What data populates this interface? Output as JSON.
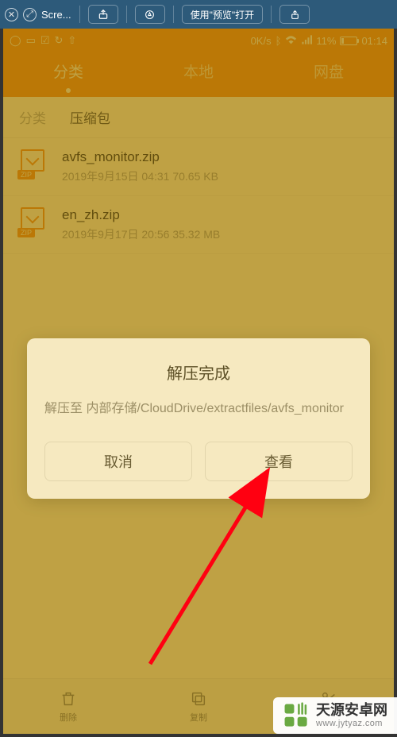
{
  "topbar": {
    "title": "Scre...",
    "open_label": "使用\"预览\"打开"
  },
  "statusbar": {
    "speed": "0K/s",
    "battery": "11%",
    "time": "01:14"
  },
  "tabs": {
    "t0": "分类",
    "t1": "本地",
    "t2": "网盘"
  },
  "bread": {
    "b0": "分类",
    "b1": "压缩包"
  },
  "files": [
    {
      "name": "avfs_monitor.zip",
      "meta": "2019年9月15日 04:31 70.65 KB",
      "badge": "ZIP"
    },
    {
      "name": "en_zh.zip",
      "meta": "2019年9月17日 20:56 35.32 MB",
      "badge": "ZIP"
    }
  ],
  "dialog": {
    "title": "解压完成",
    "msg": "解压至 内部存储/CloudDrive/extractfiles/avfs_monitor",
    "cancel": "取消",
    "view": "查看"
  },
  "bottom": {
    "b0": "删除",
    "b1": "复制",
    "b2": "剪切"
  },
  "watermark": {
    "cn": "天源安卓网",
    "url": "www.jytyaz.com"
  }
}
